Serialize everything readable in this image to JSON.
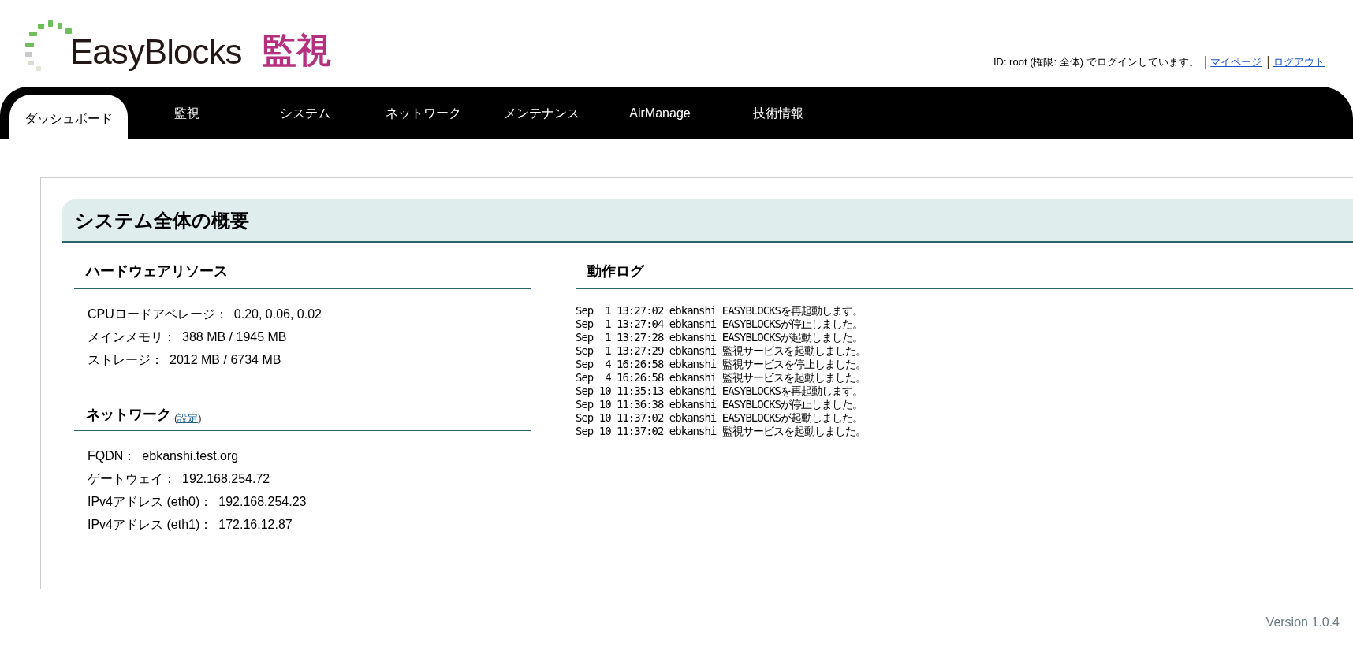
{
  "logo": {
    "wordmark": "EasyBlocks",
    "product": "監視"
  },
  "login": {
    "message": "ID: root (権限: 全体) でログインしています。",
    "separator": "|",
    "links": [
      "マイページ",
      "ログアウト"
    ]
  },
  "tabs": [
    {
      "label": "ダッシュボード",
      "selected": true
    },
    {
      "label": "監視",
      "selected": false
    },
    {
      "label": "システム",
      "selected": false
    },
    {
      "label": "ネットワーク",
      "selected": false
    },
    {
      "label": "メンテナンス",
      "selected": false
    },
    {
      "label": "AirManage",
      "selected": false
    },
    {
      "label": "技術情報",
      "selected": false
    }
  ],
  "panel": {
    "title": "システム全体の概要",
    "hardware": {
      "title": "ハードウェアリソース",
      "rows": [
        {
          "label": "CPUロードアベレージ：",
          "value": "0.20, 0.06, 0.02"
        },
        {
          "label": "メインメモリ：",
          "value": "388 MB / 1945 MB"
        },
        {
          "label": "ストレージ：",
          "value": "2012 MB / 6734 MB"
        }
      ]
    },
    "network": {
      "title": "ネットワーク",
      "link_open": "(",
      "link": "設定",
      "link_close": ")",
      "rows": [
        {
          "label": "FQDN：",
          "value": "ebkanshi.test.org"
        },
        {
          "label": "ゲートウェイ：",
          "value": "192.168.254.72"
        },
        {
          "label": "IPv4アドレス (eth0)：",
          "value": "192.168.254.23"
        },
        {
          "label": "IPv4アドレス (eth1)：",
          "value": "172.16.12.87"
        }
      ]
    },
    "log": {
      "title": "動作ログ",
      "lines": [
        "Sep  1 13:27:02 ebkanshi EASYBLOCKSを再起動します。",
        "Sep  1 13:27:04 ebkanshi EASYBLOCKSが停止しました。",
        "Sep  1 13:27:28 ebkanshi EASYBLOCKSが起動しました。",
        "Sep  1 13:27:29 ebkanshi 監視サービスを起動しました。",
        "Sep  4 16:26:58 ebkanshi 監視サービスを停止しました。",
        "Sep  4 16:26:58 ebkanshi 監視サービスを起動しました。",
        "Sep 10 11:35:13 ebkanshi EASYBLOCKSを再起動します。",
        "Sep 10 11:36:38 ebkanshi EASYBLOCKSが停止しました。",
        "Sep 10 11:37:02 ebkanshi EASYBLOCKSが起動しました。",
        "Sep 10 11:37:02 ebkanshi 監視サービスを起動しました。"
      ]
    }
  },
  "version": "Version 1.0.4"
}
